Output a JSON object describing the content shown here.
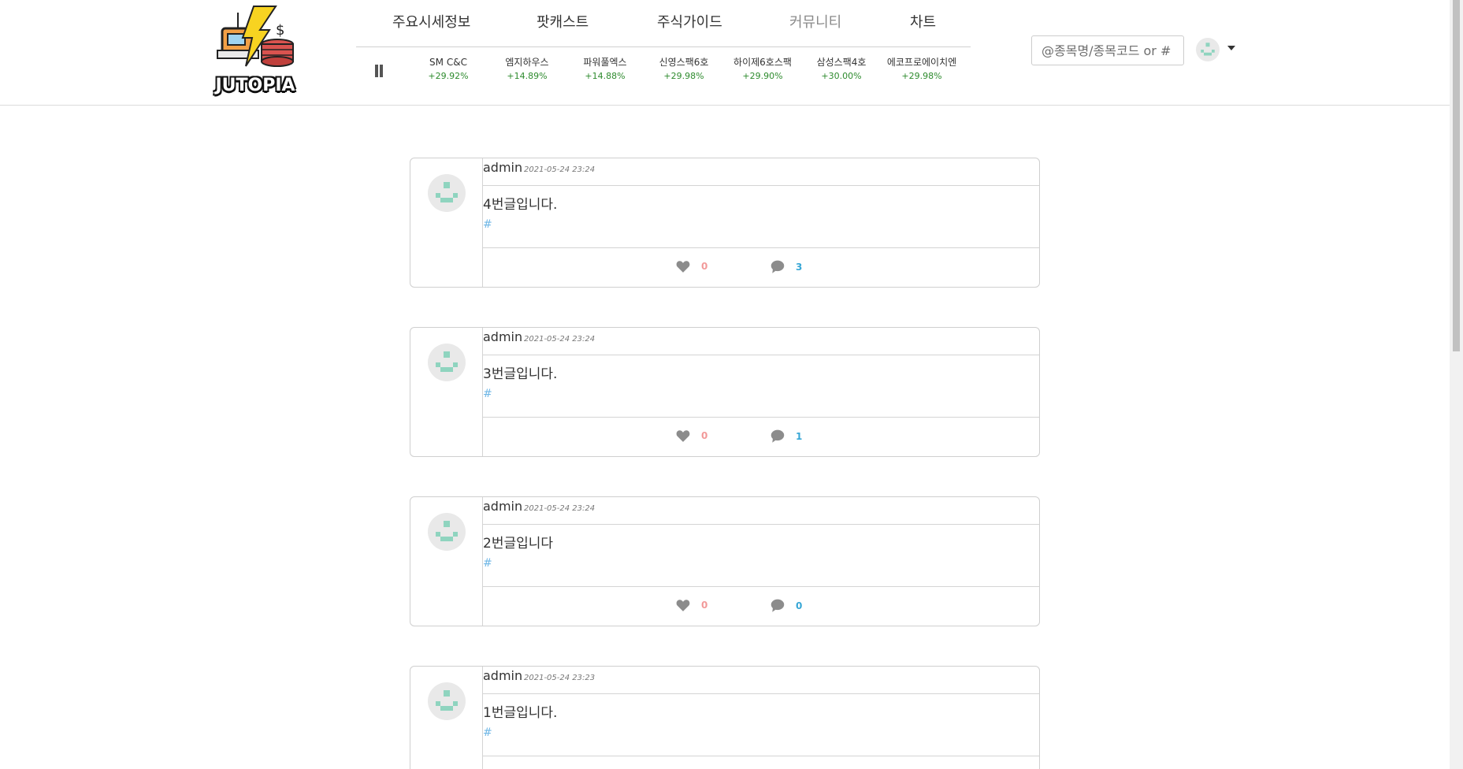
{
  "brand": {
    "logo_text": "JUTOPIA"
  },
  "nav": {
    "items": [
      "주요시세정보",
      "팟캐스트",
      "주식가이드",
      "커뮤니티",
      "차트"
    ],
    "active": "커뮤니티"
  },
  "ticker": [
    {
      "name": "SM C&C",
      "change": "+29.92%"
    },
    {
      "name": "엠지하우스",
      "change": "+14.89%"
    },
    {
      "name": "파워풀엑스",
      "change": "+14.88%"
    },
    {
      "name": "신영스팩6호",
      "change": "+29.98%"
    },
    {
      "name": "하이제6호스팩",
      "change": "+29.90%"
    },
    {
      "name": "삼성스팩4호",
      "change": "+30.00%"
    },
    {
      "name": "에코프로에이치엔",
      "change": "+29.98%"
    }
  ],
  "search": {
    "placeholder": "@종목명/종목코드 or #"
  },
  "posts": [
    {
      "author": "admin",
      "date": "2021-05-24 23:24",
      "content": "4번글입니다.",
      "hashtag": "#",
      "likes": "0",
      "comments": "3"
    },
    {
      "author": "admin",
      "date": "2021-05-24 23:24",
      "content": "3번글입니다.",
      "hashtag": "#",
      "likes": "0",
      "comments": "1"
    },
    {
      "author": "admin",
      "date": "2021-05-24 23:24",
      "content": "2번글입니다",
      "hashtag": "#",
      "likes": "0",
      "comments": "0"
    },
    {
      "author": "admin",
      "date": "2021-05-24 23:23",
      "content": "1번글입니다.",
      "hashtag": "#",
      "likes": "",
      "comments": ""
    }
  ],
  "colors": {
    "like": "#f29a9a",
    "comment": "#38a7d6",
    "ticker_up": "#2e8b2e",
    "avatar_figure": "#8fd4bf"
  },
  "icons": {
    "like": "heart-icon",
    "comment": "comment-icon",
    "pause": "pause-icon"
  }
}
